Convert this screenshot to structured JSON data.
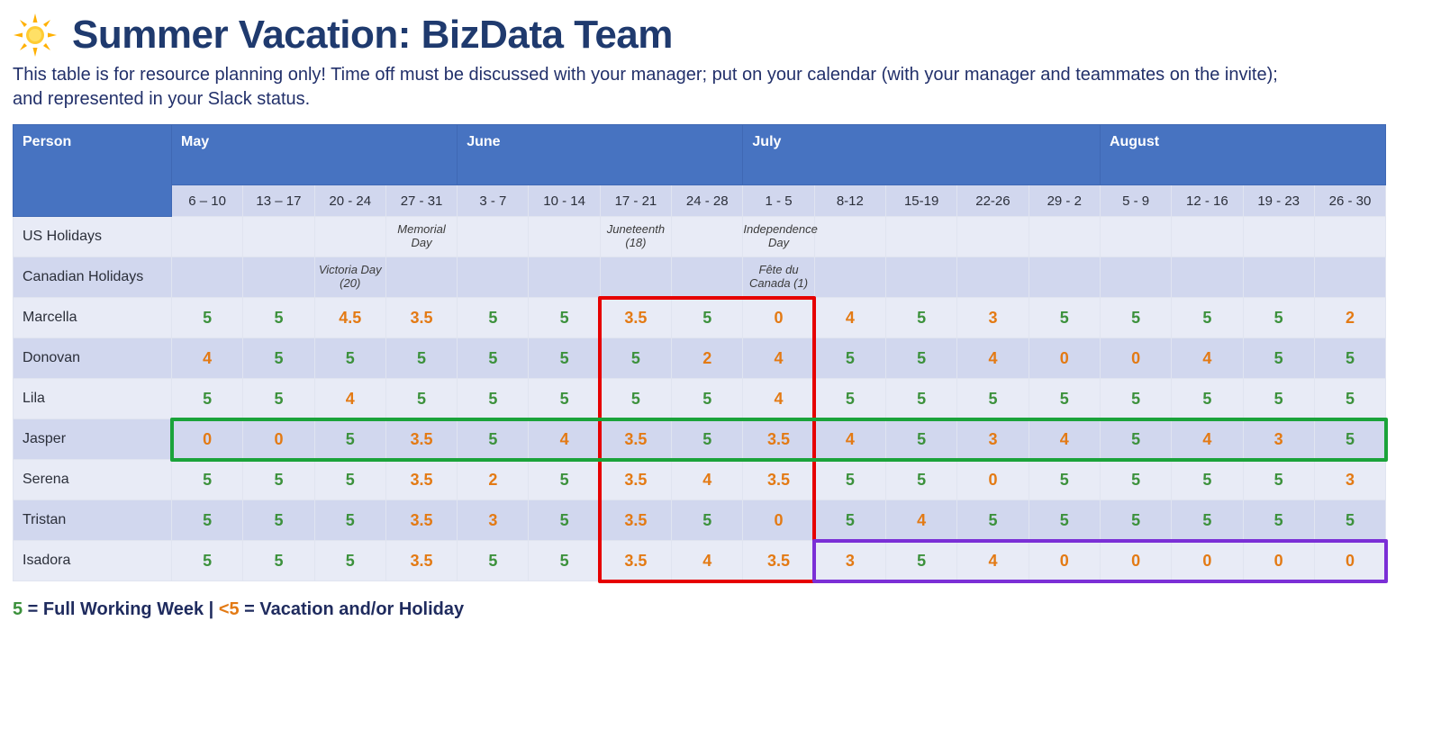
{
  "title": "Summer Vacation: BizData Team",
  "subtitle": "This table is for resource planning only! Time off must be discussed with your manager; put on your calendar (with your manager and teammates on the invite); and represented in your Slack status.",
  "header": {
    "person_label": "Person",
    "months": [
      "May",
      "June",
      "July",
      "August"
    ],
    "month_spans": [
      4,
      4,
      5,
      4
    ],
    "weeks": [
      "6 – 10",
      "13 – 17",
      "20 - 24",
      "27 - 31",
      "3 - 7",
      "10 - 14",
      "17 - 21",
      "24 - 28",
      "1 - 5",
      "8-12",
      "15-19",
      "22-26",
      "29 - 2",
      "5 - 9",
      "12 - 16",
      "19 - 23",
      "26 - 30"
    ]
  },
  "holiday_row_labels": {
    "us": "US Holidays",
    "ca": "Canadian Holidays"
  },
  "holidays": {
    "us": [
      "",
      "",
      "",
      "Memorial Day",
      "",
      "",
      "Juneteenth (18)",
      "",
      "Independence Day",
      "",
      "",
      "",
      "",
      "",
      "",
      "",
      ""
    ],
    "ca": [
      "",
      "",
      "Victoria Day (20)",
      "",
      "",
      "",
      "",
      "",
      "Fête du Canada (1)",
      "",
      "",
      "",
      "",
      "",
      "",
      "",
      ""
    ]
  },
  "people": [
    {
      "name": "Marcella",
      "values": [
        5,
        5,
        4.5,
        3.5,
        5,
        5,
        3.5,
        5,
        0,
        4,
        5,
        3,
        5,
        5,
        5,
        5,
        2
      ]
    },
    {
      "name": "Donovan",
      "values": [
        4,
        5,
        5,
        5,
        5,
        5,
        5,
        2,
        4,
        5,
        5,
        4,
        0,
        0,
        4,
        5,
        5
      ]
    },
    {
      "name": "Lila",
      "values": [
        5,
        5,
        4,
        5,
        5,
        5,
        5,
        5,
        4,
        5,
        5,
        5,
        5,
        5,
        5,
        5,
        5
      ]
    },
    {
      "name": "Jasper",
      "values": [
        0,
        0,
        5,
        3.5,
        5,
        4,
        3.5,
        5,
        3.5,
        4,
        5,
        3,
        4,
        5,
        4,
        3,
        5
      ]
    },
    {
      "name": "Serena",
      "values": [
        5,
        5,
        5,
        3.5,
        2,
        5,
        3.5,
        4,
        3.5,
        5,
        5,
        0,
        5,
        5,
        5,
        5,
        3
      ]
    },
    {
      "name": "Tristan",
      "values": [
        5,
        5,
        5,
        3.5,
        3,
        5,
        3.5,
        5,
        0,
        5,
        4,
        5,
        5,
        5,
        5,
        5,
        5
      ]
    },
    {
      "name": "Isadora",
      "values": [
        5,
        5,
        5,
        3.5,
        5,
        5,
        3.5,
        4,
        3.5,
        3,
        5,
        4,
        0,
        0,
        0,
        0,
        0
      ]
    }
  ],
  "legend": {
    "full_num": "5",
    "full_text": " = Full Working Week | ",
    "part_num": "<5",
    "part_text": " = Vacation and/or Holiday"
  },
  "chart_data": {
    "type": "table",
    "title": "Summer Vacation: BizData Team — planned working days per week",
    "columns": [
      "May 6–10",
      "May 13–17",
      "May 20-24",
      "May 27-31",
      "Jun 3-7",
      "Jun 10-14",
      "Jun 17-21",
      "Jun 24-28",
      "Jul 1-5",
      "Jul 8-12",
      "Jul 15-19",
      "Jul 22-26",
      "Jul 29-Aug 2",
      "Aug 5-9",
      "Aug 12-16",
      "Aug 19-23",
      "Aug 26-30"
    ],
    "series": [
      {
        "name": "Marcella",
        "values": [
          5,
          5,
          4.5,
          3.5,
          5,
          5,
          3.5,
          5,
          0,
          4,
          5,
          3,
          5,
          5,
          5,
          5,
          2
        ]
      },
      {
        "name": "Donovan",
        "values": [
          4,
          5,
          5,
          5,
          5,
          5,
          5,
          2,
          4,
          5,
          5,
          4,
          0,
          0,
          4,
          5,
          5
        ]
      },
      {
        "name": "Lila",
        "values": [
          5,
          5,
          4,
          5,
          5,
          5,
          5,
          5,
          4,
          5,
          5,
          5,
          5,
          5,
          5,
          5,
          5
        ]
      },
      {
        "name": "Jasper",
        "values": [
          0,
          0,
          5,
          3.5,
          5,
          4,
          3.5,
          5,
          3.5,
          4,
          5,
          3,
          4,
          5,
          4,
          3,
          5
        ]
      },
      {
        "name": "Serena",
        "values": [
          5,
          5,
          5,
          3.5,
          2,
          5,
          3.5,
          4,
          3.5,
          5,
          5,
          0,
          5,
          5,
          5,
          5,
          3
        ]
      },
      {
        "name": "Tristan",
        "values": [
          5,
          5,
          5,
          3.5,
          3,
          5,
          3.5,
          5,
          0,
          5,
          4,
          5,
          5,
          5,
          5,
          5,
          5
        ]
      },
      {
        "name": "Isadora",
        "values": [
          5,
          5,
          5,
          3.5,
          5,
          5,
          3.5,
          4,
          3.5,
          3,
          5,
          4,
          0,
          0,
          0,
          0,
          0
        ]
      }
    ],
    "notes": {
      "US Holidays": {
        "May 27-31": "Memorial Day",
        "Jun 17-21": "Juneteenth (18)",
        "Jul 1-5": "Independence Day"
      },
      "Canadian Holidays": {
        "May 20-24": "Victoria Day (20)",
        "Jul 1-5": "Fête du Canada (1)"
      }
    }
  }
}
